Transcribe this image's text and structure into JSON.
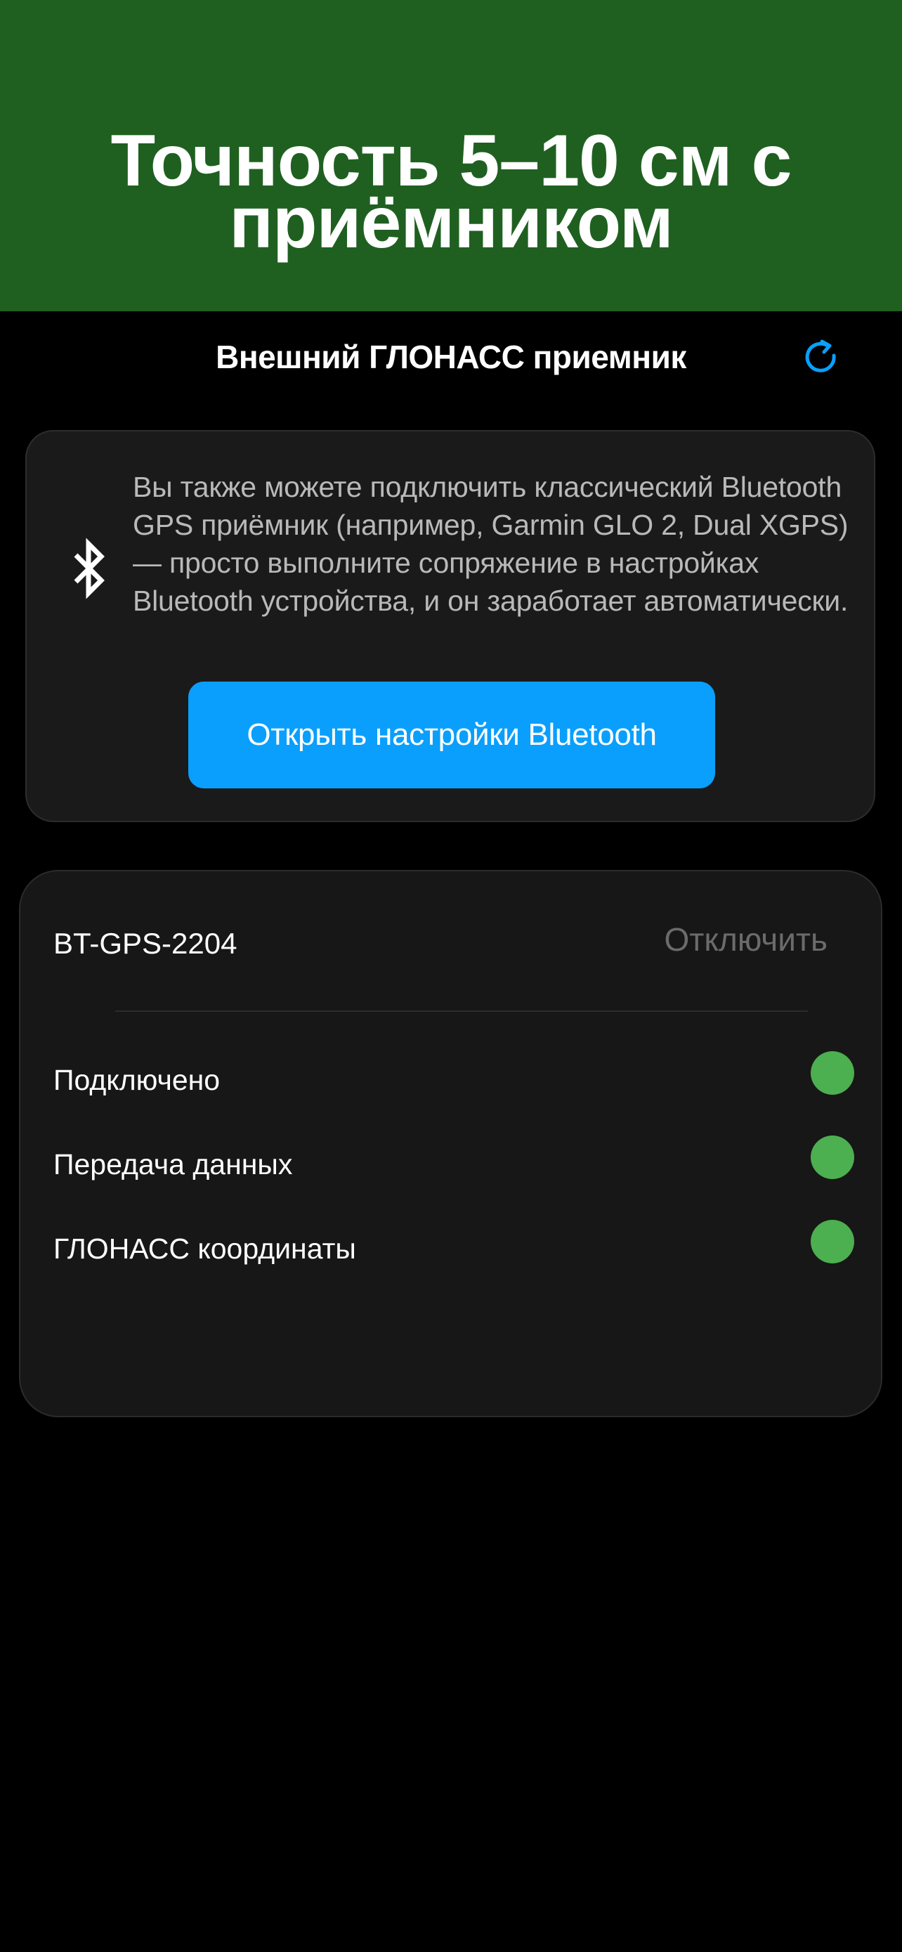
{
  "banner": {
    "title": "Точность 5–10 см с приёмником",
    "color": "#1f6021"
  },
  "header": {
    "title": "Внешний ГЛОНАСС приемник",
    "refresh_icon": "refresh-icon"
  },
  "bluetooth_card": {
    "icon": "bluetooth-icon",
    "text": "Вы также можете подключить классический Bluetooth GPS приёмник (например, Garmin GLO 2, Dual XGPS) — просто выполните сопряжение в настройках Bluetooth устройства, и он заработает автоматически.",
    "button_label": "Открыть настройки Bluetooth",
    "button_color": "#0a9ffc"
  },
  "device": {
    "name": "BT-GPS-2204",
    "disconnect_label": "Отключить",
    "statuses": [
      {
        "label": "Подключено",
        "ok": true
      },
      {
        "label": "Передача данных",
        "ok": true
      },
      {
        "label": "ГЛОНАСС координаты",
        "ok": true
      }
    ],
    "ok_color": "#4caf50"
  }
}
